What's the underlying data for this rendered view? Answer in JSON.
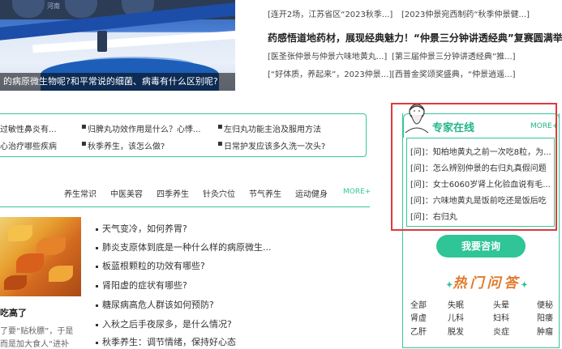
{
  "hero": {
    "caption": "的病原微生物呢?和平常说的细菌、病毒有什么区别呢?",
    "sign_text": "河南"
  },
  "news": {
    "row1": [
      "[连开2场，江苏省区“2023秋季...]",
      "[2023仲景宛西制药“秋季仲景健...]"
    ],
    "headline": "药感悟道地药材，展现经典魅力！“仲景三分钟讲透经典”复赛圆满举办",
    "row2": [
      "[医圣张仲景与仲景六味地黄丸...]",
      "[第三届仲景三分钟讲透经典”推...]"
    ],
    "row3": [
      "[“好体质，养起来”，2023仲景...]",
      "[西普金奖颂奖盛典，“仲景逍遥...]"
    ]
  },
  "links": {
    "col1": [
      "过敏性鼻炎有...",
      "心治疗哪些疾病"
    ],
    "col2": [
      "归脾丸功效作用是什么？心悸...",
      "秋季养生，该怎么做?"
    ],
    "col3": [
      "左归丸功能主治及服用方法",
      "日常护发应该多久洗一次头?"
    ]
  },
  "categories": {
    "items": [
      "养生常识",
      "中医美容",
      "四季养生",
      "针灸穴位",
      "节气养生",
      "运动健身"
    ],
    "more": "MORE+"
  },
  "feature": {
    "title": "吃高了",
    "text1": "了要“贴秋膘”，于是",
    "text2": "而是加大食人“进补"
  },
  "articles": [
    "天气变冷，如何养胃?",
    "肺炎支原体到底是一种什么样的病原微生...",
    "板蓝根颗粒的功效有哪些?",
    "肾阳虚的症状有哪些?",
    "糖尿病高危人群该如何预防?",
    "入秋之后手夜尿多，是什么情况?",
    "秋季养生：调节情绪，保持好心态"
  ],
  "expert": {
    "title": "专家在线",
    "more": "MORE+",
    "questions": [
      "[问]：知柏地黄丸之前一次吃8粒，为...",
      "[问]：怎么辨别仲景的右归丸真假问题",
      "[问]：女士6060岁肾上化验血说有毛...",
      "[问]：六味地黄丸是饭前吃还是饭后吃",
      "[问]：右归丸"
    ],
    "ask_button": "我要咨询"
  },
  "hot": {
    "title": "热门问答",
    "rows": [
      [
        "全部",
        "失眠",
        "头晕",
        "便秘"
      ],
      [
        "肾虚",
        "儿科",
        "妇科",
        "阳痿"
      ],
      [
        "乙肝",
        "脱发",
        "炎症",
        "肿瘤"
      ]
    ]
  },
  "colors": {
    "accent": "#35c69a",
    "button": "#2fc596",
    "highlight_frame": "#e0393e",
    "hot_title": "#e07a2a"
  }
}
